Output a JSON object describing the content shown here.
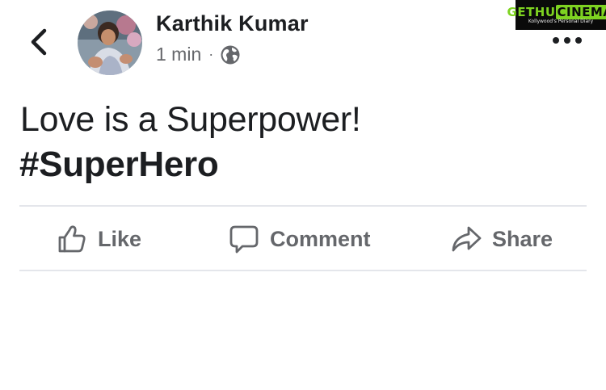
{
  "post": {
    "author": "Karthik Kumar",
    "timestamp": "1 min",
    "separator": "·",
    "audience_icon": "globe-icon",
    "text": "Love is a Superpower!",
    "hashtag": "#SuperHero"
  },
  "actions": {
    "like": "Like",
    "comment": "Comment",
    "share": "Share"
  },
  "watermark": {
    "brand_prefix": "GETHU",
    "brand_highlight": "CINEMA",
    "tagline": "Kollywood's Personal Diary"
  },
  "colors": {
    "text_primary": "#1c1e21",
    "text_secondary": "#65676b",
    "divider": "#e4e6eb",
    "watermark_bg": "#0a0a0a",
    "watermark_green": "#7ed321"
  }
}
